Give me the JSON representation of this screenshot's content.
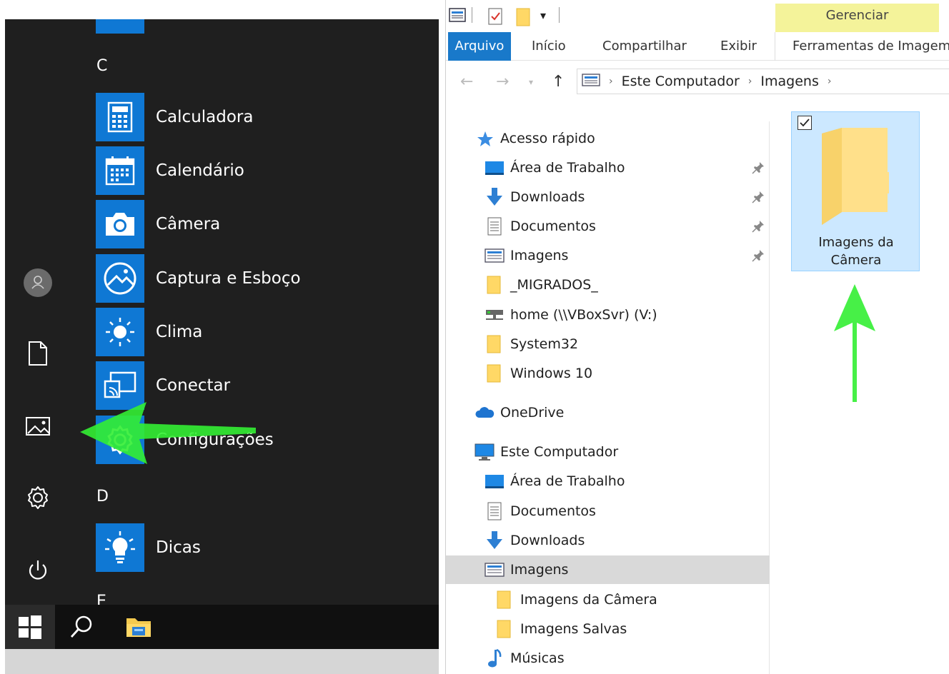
{
  "start_menu": {
    "letters": {
      "c": "C",
      "d": "D",
      "e": "E"
    },
    "apps": [
      {
        "label": "Calculadora",
        "icon": "calculator-icon"
      },
      {
        "label": "Calendário",
        "icon": "calendar-icon"
      },
      {
        "label": "Câmera",
        "icon": "camera-icon"
      },
      {
        "label": "Captura e Esboço",
        "icon": "snip-sketch-icon"
      },
      {
        "label": "Clima",
        "icon": "weather-sun-icon"
      },
      {
        "label": "Conectar",
        "icon": "connect-cast-icon"
      },
      {
        "label": "Configurações",
        "icon": "settings-gear-icon"
      },
      {
        "label": "Dicas",
        "icon": "lightbulb-icon"
      }
    ],
    "rail": [
      "user-avatar-icon",
      "documents-icon",
      "pictures-icon",
      "settings-icon",
      "power-icon"
    ]
  },
  "taskbar": {
    "items": [
      "windows-start-icon",
      "search-icon",
      "file-explorer-icon"
    ]
  },
  "explorer": {
    "contextual_tab": "Gerenciar",
    "tabs": {
      "file": "Arquivo",
      "home": "Início",
      "share": "Compartilhar",
      "view": "Exibir",
      "tools": "Ferramentas de Imagem"
    },
    "address": {
      "root": "Este Computador",
      "folder": "Imagens"
    },
    "nav": {
      "quick_access": "Acesso rápido",
      "desktop": "Área de Trabalho",
      "downloads": "Downloads",
      "documents": "Documentos",
      "pictures": "Imagens",
      "migrados": "_MIGRADOS_",
      "home_share": "home (\\\\VBoxSvr) (V:)",
      "system32": "System32",
      "windows10": "Windows 10",
      "onedrive": "OneDrive",
      "this_pc": "Este Computador",
      "pc_desktop": "Área de Trabalho",
      "pc_documents": "Documentos",
      "pc_downloads": "Downloads",
      "pc_pictures": "Imagens",
      "camera_roll": "Imagens da Câmera",
      "saved_pictures": "Imagens Salvas",
      "music": "Músicas"
    },
    "content": {
      "item_label_line1": "Imagens da",
      "item_label_line2": "Câmera"
    }
  },
  "colors": {
    "start_bg": "#1f1f1f",
    "tile_blue": "#0f78d4",
    "arrow_green": "#33ee33",
    "file_tab": "#1979ca",
    "manage_yellow": "#f4f39a"
  }
}
